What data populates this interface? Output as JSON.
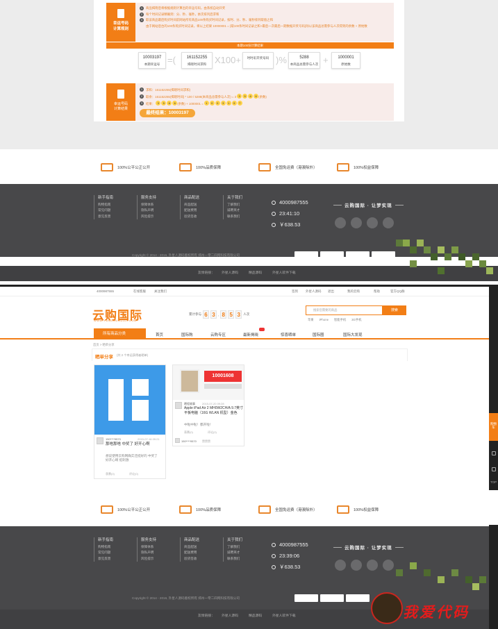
{
  "rule": {
    "icon_title": "幸运号码",
    "icon_subtitle": "计算规则",
    "lines": [
      "商品揭晓后将根据规则计算出的幸运号码，由系统自动开奖",
      "每个时间记录精确到：分、秒、毫秒，依次排列后求和",
      "取该商品最后购买时间前网站所有商品100条购买时间记录，按时、分、秒、毫秒排列取值之和",
      "由于网站后台的100条购买时间记录，将以上结果 10000001 = {取100条时间记录之和+最后一次最后一期数据开奖号码}除以该商品总需参与人次得到的余数 + 原始数"
    ],
    "bar_text": "本期100份计算结果",
    "formula": {
      "b1_value": "10003197",
      "b1_label": "本期幸运号",
      "eq": "=(",
      "b2_value": "161152255",
      "b2_label": "揭晓时间求和",
      "op1": "X100+",
      "b3_value": "时时彩开奖号码",
      "b3_label": "",
      "op2": ")%",
      "b4_value": "5288",
      "b4_label": "本商品总需参与人次",
      "op3": "+",
      "b5_value": "1000001",
      "b5_label": "原始数"
    }
  },
  "result": {
    "icon_title": "幸运号码",
    "icon_subtitle": "计算结果",
    "line1": "求和：161152255(揭晓时间求和)",
    "line2": "取余：161152255(揭晓时间) * 100 / 5288(本商品总需参与人次) = 3",
    "line2_balls": [
      "3",
      "5",
      "6",
      "6"
    ],
    "line2_suffix": "(余数)",
    "line3_prefix": "结果：",
    "line3_balls": [
      "3",
      "5",
      "6",
      "6"
    ],
    "line3_mid": "(余数) + 1000001 =",
    "line3_result": [
      "1",
      "0",
      "0",
      "3",
      "1",
      "9",
      "7"
    ],
    "final_label": "最终结果：10003197"
  },
  "features": [
    {
      "icon": "scale-icon",
      "label": "100%公平公正公开"
    },
    {
      "icon": "trophy-icon",
      "label": "100%品质保障"
    },
    {
      "icon": "truck-icon",
      "label": "全国免运费（港澳除外）"
    },
    {
      "icon": "gavel-icon",
      "label": "100%权益保障"
    }
  ],
  "footer": {
    "cols": [
      {
        "title": "新手指南",
        "items": [
          "购物指南",
          "常见问题",
          "意见反馈"
        ]
      },
      {
        "title": "服务支持",
        "items": [
          "保障体系",
          "隐私声明",
          "风险提示"
        ]
      },
      {
        "title": "商品配送",
        "items": [
          "商品配送",
          "配送费用",
          "验货签收"
        ]
      },
      {
        "title": "关于我们",
        "items": [
          "了解我们",
          "诚聘英才",
          "联系我们"
        ]
      }
    ],
    "phone": "4000987555",
    "time1": "23:41:10",
    "time2": "23:39:06",
    "amount": "￥638.53",
    "slogan": "云购国际 · 让梦实现",
    "copyright": "Copyright © 2014 - 2016, 外星人源码版权所有 郑州一零二四网科技有限公司",
    "links_label": "友情链接：",
    "links": [
      "外星人源码",
      "精品源码",
      "外星人软件下载"
    ]
  },
  "topbar": {
    "phone": "4000987555",
    "online": "在线客服",
    "follow": "关注我们",
    "right": [
      "签到",
      "外星人源码",
      "退出",
      "我的云购",
      "帮助",
      "官方QQ群"
    ]
  },
  "header": {
    "logo": "云购国际",
    "logo_sub": "WWW.YUNGOUGUOJI.COM",
    "counter_label": "累计参与",
    "counter_digits": [
      "6",
      "3",
      ",",
      "8",
      "5",
      "3"
    ],
    "counter_unit": "人次",
    "search_placeholder": "搜索您需要的商品",
    "search_button": "搜索",
    "hotwords": [
      "苹果",
      "iPhone",
      "智能手机",
      "3G手机"
    ]
  },
  "nav": {
    "all": "所有商品分类",
    "items": [
      "首页",
      "国际购",
      "云购专区",
      "最新揭晓",
      "惊喜晒单",
      "国际圈",
      "国际大发现"
    ]
  },
  "breadcrumb": "首页 > 晒单分享",
  "share": {
    "title": "晒单分享",
    "subtitle": "(共 2 个幸运获得者晒单)"
  },
  "cards": [
    {
      "user": "150****9570",
      "date": "2015-07-16 09:21",
      "title": "那啥那啥 中奖了 好开心啊",
      "body": "想说使用云购网确实还挺好的 中奖了 好开心啊 挺刺激",
      "likes": "羡慕(0)",
      "comments": "评论(0)"
    },
    {
      "banner": "10001608",
      "user": "晒程故事",
      "date": "2015-07-20 09:28",
      "title": "Apple iPad Air 2 MH0W2CH/A 9.7英寸平板电脑（16G WLAN 机型）金色",
      "body": "中啦中啦！都开啦！",
      "likes": "羡慕(0)",
      "comments": "评论(0)",
      "commenter": "150****9570",
      "comment_text": "赞赞赞"
    }
  ],
  "side": {
    "tab": "购物车",
    "top": "TOP"
  },
  "watermark": "我爱代码",
  "colors": {
    "accent": "#f27e16",
    "footer_bg": "#48484a",
    "rule_bg": "#f8ecea"
  }
}
